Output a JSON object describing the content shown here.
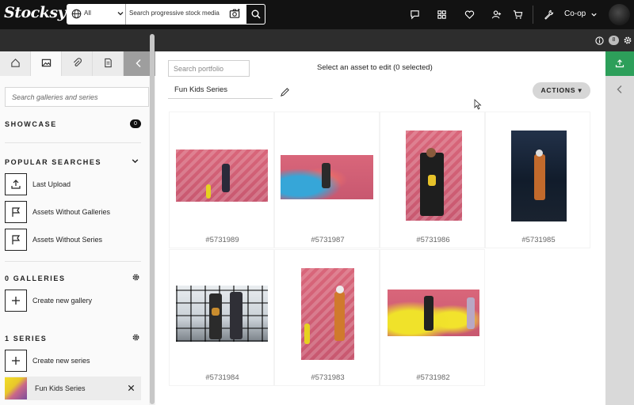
{
  "brand": {
    "logo": "Stocksy"
  },
  "search": {
    "category": "All",
    "placeholder": "Search progressive stock media"
  },
  "topnav": {
    "account_label": "Co-op"
  },
  "subbar": {
    "notification_count": "8"
  },
  "sidebar": {
    "gallery_search_placeholder": "Search galleries and series",
    "showcase": {
      "title": "SHOWCASE",
      "count": "0"
    },
    "popular": {
      "title": "POPULAR SEARCHES",
      "items": [
        {
          "label": "Last Upload",
          "icon": "upload-icon"
        },
        {
          "label": "Assets Without Galleries",
          "icon": "flag-icon"
        },
        {
          "label": "Assets Without Series",
          "icon": "flag-icon"
        }
      ]
    },
    "galleries": {
      "title": "0 GALLERIES",
      "create_label": "Create new gallery"
    },
    "series": {
      "title": "1 SERIES",
      "create_label": "Create new series",
      "items": [
        {
          "name": "Fun Kids Series"
        }
      ]
    }
  },
  "main": {
    "portfolio_search_placeholder": "Search portfolio",
    "selection_message": "Select an asset to edit (0 selected)",
    "series_name": "Fun Kids Series",
    "actions_label": "ACTIONS ▾",
    "assets": [
      {
        "id": "#5731989"
      },
      {
        "id": "#5731987"
      },
      {
        "id": "#5731986"
      },
      {
        "id": "#5731985"
      },
      {
        "id": "#5731984"
      },
      {
        "id": "#5731983"
      },
      {
        "id": "#5731982"
      }
    ]
  },
  "colors": {
    "topbar": "#121212",
    "subbar": "#2d2d2d",
    "accent_green": "#2d9f5a",
    "actions_button": "#d6d6d6"
  }
}
